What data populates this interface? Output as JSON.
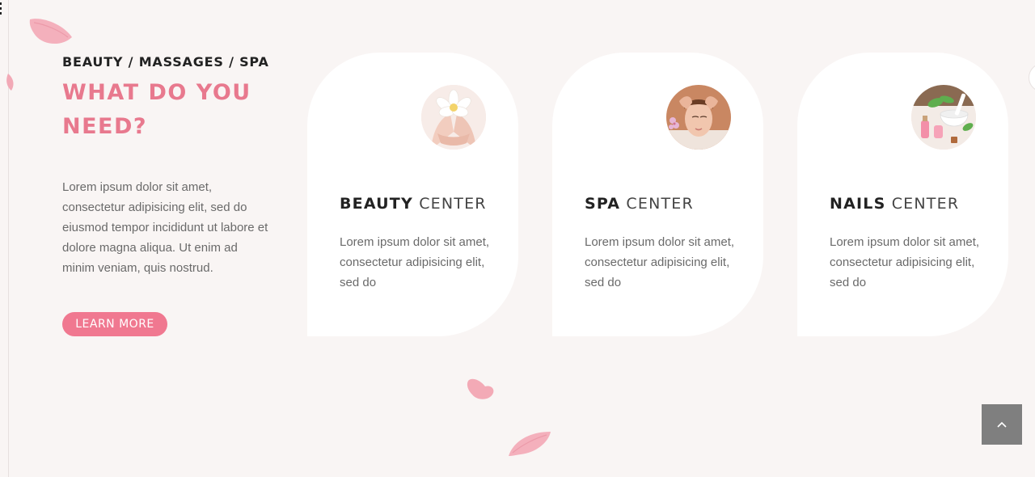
{
  "intro": {
    "eyebrow": "BEAUTY / MASSAGES / SPA",
    "headline_line1": "WHAT DO YOU",
    "headline_line2": "NEED?",
    "text": "Lorem ipsum dolor sit amet, consectetur adipisicing elit, sed do eiusmod tempor incididunt ut labore et dolore magna aliqua. Ut enim ad minim veniam, quis nostrud.",
    "button_label": "LEARN MORE"
  },
  "cards": [
    {
      "title_bold": "BEAUTY",
      "title_light": "CENTER",
      "text": "Lorem ipsum dolor sit amet, consectetur adipisicing elit, sed do",
      "image": "hands-holding-flower"
    },
    {
      "title_bold": "SPA",
      "title_light": "CENTER",
      "text": "Lorem ipsum dolor sit amet, consectetur adipisicing elit, sed do",
      "image": "face-massage"
    },
    {
      "title_bold": "NAILS",
      "title_light": "CENTER",
      "text": "Lorem ipsum dolor sit amet, consectetur adipisicing elit, sed do",
      "image": "spa-products"
    }
  ],
  "scroll_top": {
    "icon": "chevron-up-icon"
  },
  "colors": {
    "background": "#f9f5f4",
    "accent": "#e8798e",
    "button": "#f07890",
    "card": "#ffffff",
    "scroll_button": "#7f7f7f"
  }
}
